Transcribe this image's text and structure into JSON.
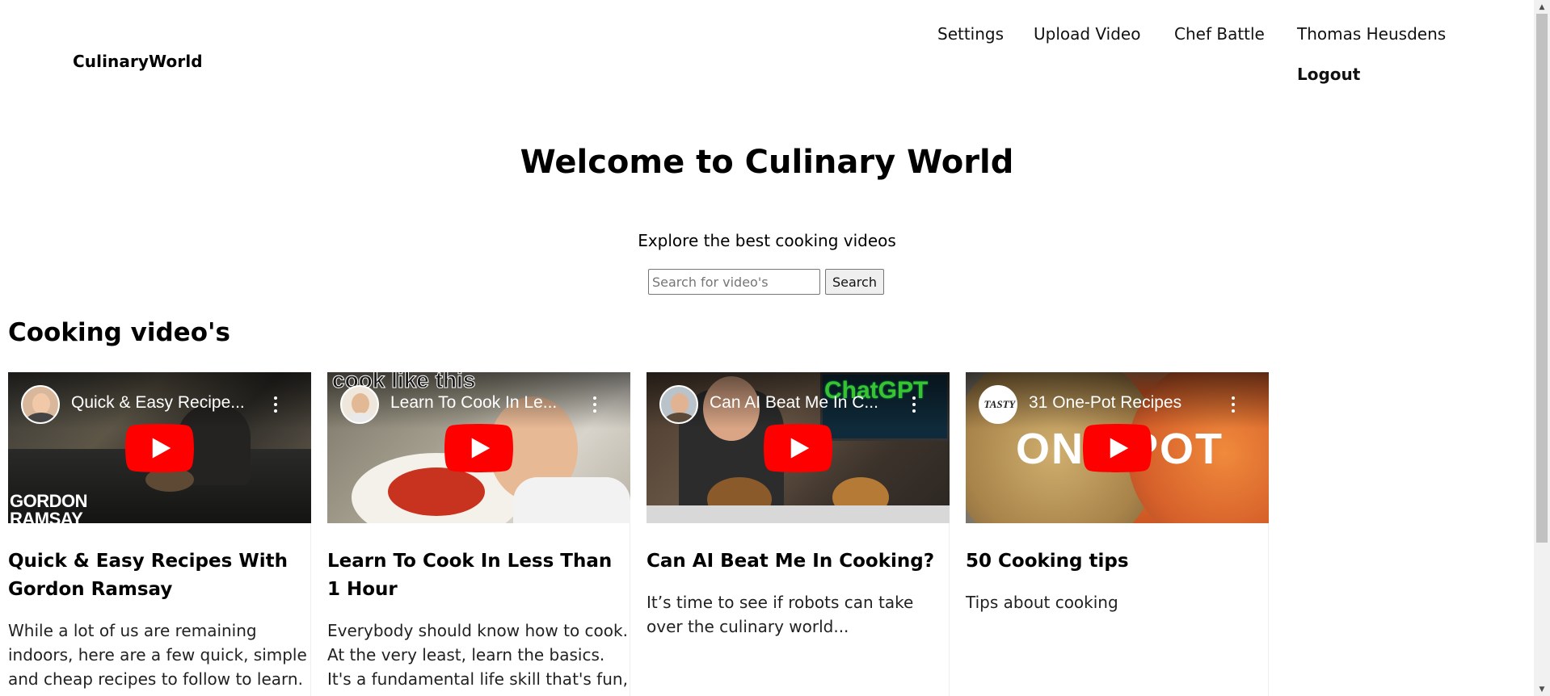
{
  "header": {
    "brand": "CulinaryWorld",
    "nav": {
      "settings": "Settings",
      "upload_video": "Upload Video",
      "chef_battle": "Chef Battle",
      "user": "Thomas Heusdens",
      "logout": "Logout"
    }
  },
  "hero": {
    "title": "Welcome to Culinary World",
    "subtitle": "Explore the best cooking videos",
    "search": {
      "placeholder": "Search for video's",
      "button_label": "Search"
    }
  },
  "section": {
    "title": "Cooking video's"
  },
  "colors": {
    "youtube_red": "#ff0000",
    "text": "#000000"
  },
  "cards": [
    {
      "video_title": "Quick & Easy Recipe...",
      "thumb_caption": "GORDON RAMSAY",
      "title": "Quick & Easy Recipes With Gordon Ramsay",
      "description": "While a lot of us are remaining indoors, here are a few quick, simple and cheap recipes to follow to learn."
    },
    {
      "video_title": "Learn To Cook In Le...",
      "thumb_caption": "cook like this",
      "title": "Learn To Cook In Less Than 1 Hour",
      "description": "Everybody should know how to cook. At the very least, learn the basics. It's a fundamental life skill that's fun,"
    },
    {
      "video_title": "Can AI Beat Me In C...",
      "thumb_caption": "ChatGPT",
      "title": "Can AI Beat Me In Cooking?",
      "description": "It’s time to see if robots can take over the culinary world..."
    },
    {
      "video_title": "31 One-Pot Recipes",
      "thumb_caption": "ONE POT",
      "title": "50 Cooking tips",
      "description": "Tips about cooking"
    }
  ]
}
